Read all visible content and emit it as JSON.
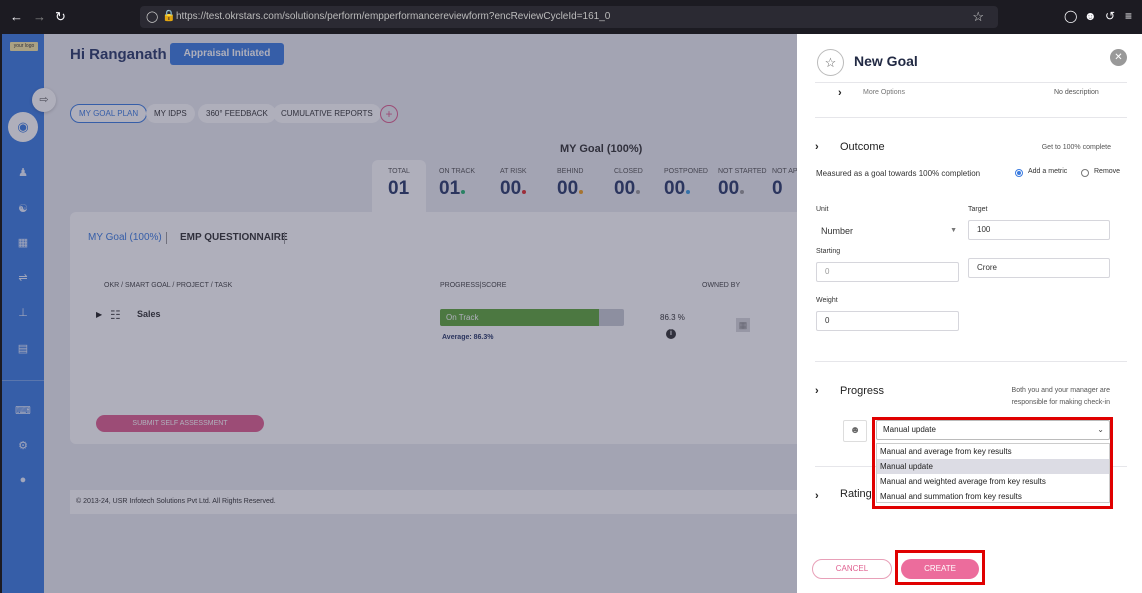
{
  "browser": {
    "url": "https://test.okrstars.com/solutions/perform/empperformancereviewform?encReviewCycleId=161_0"
  },
  "sidebar": {
    "logo_text": "your logo"
  },
  "header": {
    "greeting": "Hi Ranganath",
    "status_badge": "Appraisal Initiated"
  },
  "tabs": [
    "MY GOAL PLAN",
    "MY IDPS",
    "360° FEEDBACK",
    "CUMULATIVE REPORTS"
  ],
  "summary": {
    "title": "MY Goal (100%)",
    "stats": [
      {
        "label": "TOTAL",
        "value": "01",
        "dot": ""
      },
      {
        "label": "ON TRACK",
        "value": "01",
        "dot": "#2bb673"
      },
      {
        "label": "AT RISK",
        "value": "00",
        "dot": "#e03030"
      },
      {
        "label": "BEHIND",
        "value": "00",
        "dot": "#f0a020"
      },
      {
        "label": "CLOSED",
        "value": "00",
        "dot": "#999999"
      },
      {
        "label": "POSTPONED",
        "value": "00",
        "dot": "#3c9ce0"
      },
      {
        "label": "NOT STARTED",
        "value": "00",
        "dot": "#999999"
      },
      {
        "label": "NOT AP",
        "value": "0"
      }
    ]
  },
  "panel": {
    "tab_goal": "MY Goal (100%)",
    "tab_questionnaire": "EMP QUESTIONNAIRE",
    "col_goal": "OKR / SMART GOAL / PROJECT / TASK",
    "col_progress": "PROGRESS|SCORE",
    "col_owner": "OWNED BY",
    "row_name": "Sales",
    "row_status": "On Track",
    "row_progress_fraction": 0.863,
    "row_average": "Average: 86.3%",
    "row_pct": "86.3  %",
    "submit_label": "SUBMIT SELF ASSESSMENT"
  },
  "footer": "© 2013-24, USR Infotech Solutions Pvt Ltd. All Rights Reserved.",
  "drawer": {
    "title": "New Goal",
    "more_options": "More Options",
    "no_description": "No description",
    "outcome": {
      "label": "Outcome",
      "note": "Get to 100% complete",
      "measured_text": "Measured as a goal towards 100% completion",
      "add_metric": "Add a metric",
      "remove": "Remove",
      "unit_label": "Unit",
      "unit_value": "Number",
      "target_label": "Target",
      "target_value": "100",
      "starting_label": "Starting",
      "starting_value": "0",
      "scale_value": "Crore",
      "weight_label": "Weight",
      "weight_value": "0"
    },
    "progress": {
      "label": "Progress",
      "note_line1": "Both you and your manager are",
      "note_line2": "responsible for making check-in",
      "selected": "Manual update",
      "options": [
        "Manual and average from key results",
        "Manual update",
        "Manual and weighted average from key results",
        "Manual and summation from key results"
      ]
    },
    "rating_label": "Rating",
    "cancel_label": "CANCEL",
    "create_label": "CREATE"
  }
}
